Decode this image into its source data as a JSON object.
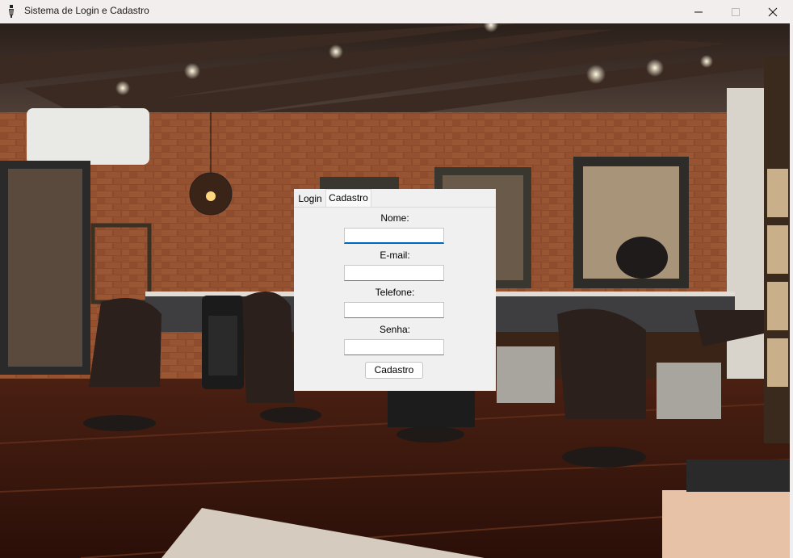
{
  "window": {
    "title": "Sistema de Login e Cadastro",
    "icon": "feather-icon",
    "controls": [
      "minimize",
      "maximize",
      "close"
    ]
  },
  "tabs": [
    {
      "label": "Login",
      "selected": false
    },
    {
      "label": "Cadastro",
      "selected": true
    }
  ],
  "form": {
    "fields": [
      {
        "label": "Nome:",
        "value": "",
        "focused": true
      },
      {
        "label": "E-mail:",
        "value": ""
      },
      {
        "label": "Telefone:",
        "value": ""
      },
      {
        "label": "Senha:",
        "value": ""
      }
    ],
    "submit_label": "Cadastro"
  },
  "background": {
    "description_icon": "barbershop-image"
  }
}
